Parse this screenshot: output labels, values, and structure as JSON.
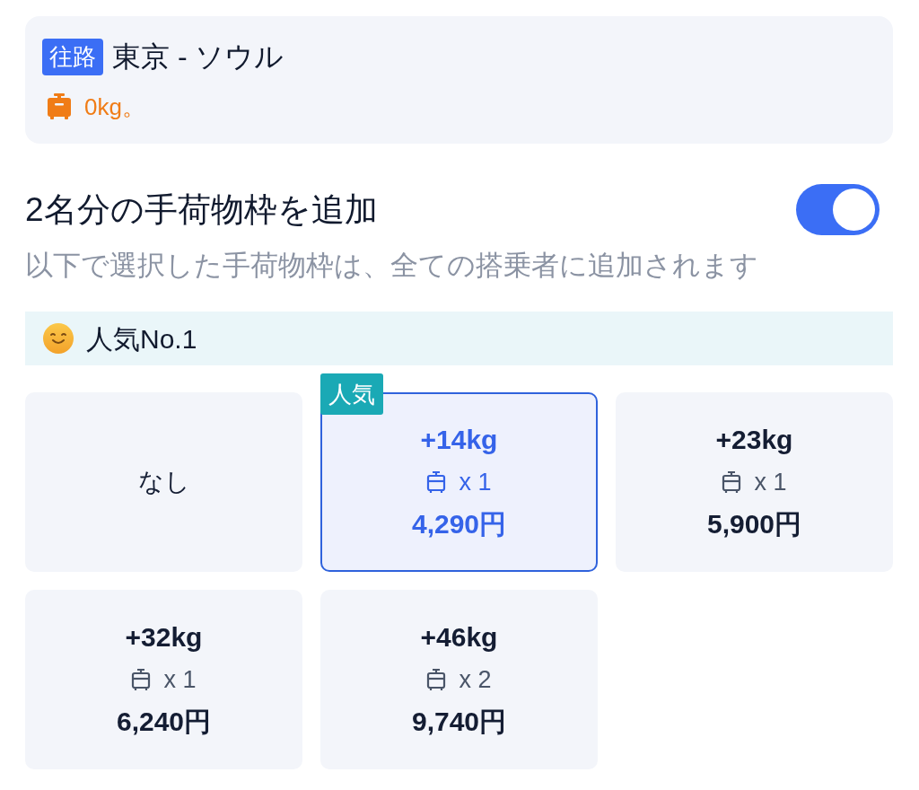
{
  "route": {
    "badge": "往路",
    "title": "東京 - ソウル",
    "baggage": "0kg。"
  },
  "add_baggage": {
    "title": "2名分の手荷物枠を追加",
    "on": true,
    "description": "以下で選択した手荷物枠は、全ての搭乗者に追加されます"
  },
  "popular_banner": {
    "label": "人気No.1"
  },
  "options": [
    {
      "kind": "none",
      "label": "なし",
      "selected": false
    },
    {
      "kind": "weight",
      "weight": "+14kg",
      "quantity": "x 1",
      "price": "4,290円",
      "selected": true,
      "badge": "人気"
    },
    {
      "kind": "weight",
      "weight": "+23kg",
      "quantity": "x 1",
      "price": "5,900円",
      "selected": false
    },
    {
      "kind": "weight",
      "weight": "+32kg",
      "quantity": "x 1",
      "price": "6,240円",
      "selected": false
    },
    {
      "kind": "weight",
      "weight": "+46kg",
      "quantity": "x 2",
      "price": "9,740円",
      "selected": false
    }
  ]
}
